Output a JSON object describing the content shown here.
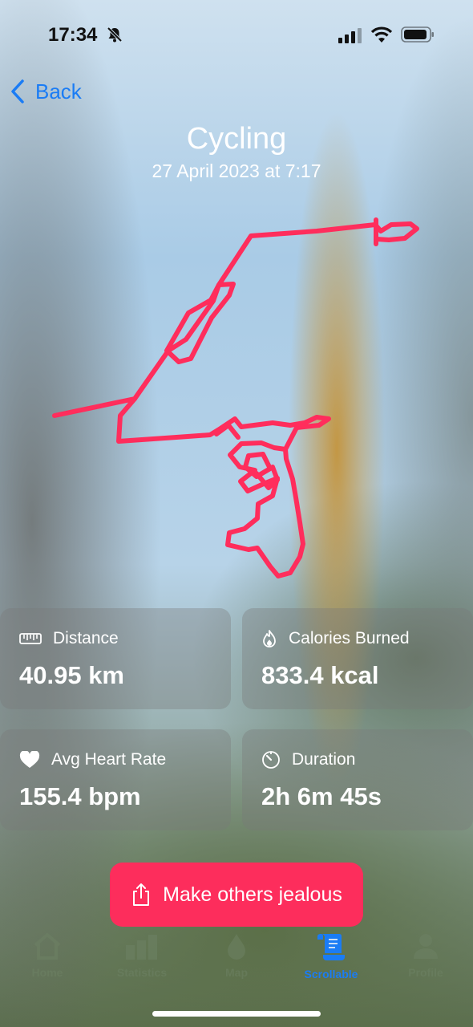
{
  "status_bar": {
    "time": "17:34"
  },
  "nav": {
    "back_label": "Back"
  },
  "activity": {
    "title": "Cycling",
    "date": "27 April 2023 at 7:17"
  },
  "colors": {
    "route": "#ff2d5c",
    "accent": "#1a7cf5",
    "button": "#fd2d5c"
  },
  "stats": [
    {
      "label": "Distance",
      "value": "40.95 km",
      "icon": "ruler-icon"
    },
    {
      "label": "Calories Burned",
      "value": "833.4 kcal",
      "icon": "flame-icon"
    },
    {
      "label": "Avg Heart Rate",
      "value": "155.4 bpm",
      "icon": "heart-icon"
    },
    {
      "label": "Duration",
      "value": "2h 6m 45s",
      "icon": "timer-icon"
    }
  ],
  "share_button": {
    "label": "Make others jealous",
    "icon": "share-icon"
  },
  "tabs": [
    {
      "label": "Home",
      "icon": "home-icon",
      "active": false
    },
    {
      "label": "Statistics",
      "icon": "bar-chart-icon",
      "active": false
    },
    {
      "label": "Map",
      "icon": "drop-icon",
      "active": false
    },
    {
      "label": "Scrollable",
      "icon": "scroll-icon",
      "active": true
    },
    {
      "label": "Profile",
      "icon": "person-icon",
      "active": false
    }
  ]
}
